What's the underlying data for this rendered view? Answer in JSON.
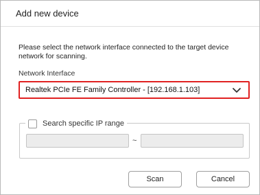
{
  "dialog": {
    "title": "Add new device",
    "description": "Please select the network interface connected to the target device network for scanning.",
    "network_interface_label": "Network Interface",
    "network_interface_selected": "Realtek PCIe FE Family Controller - [192.168.1.103]",
    "ip_range_checkbox_label": "Search specific IP range",
    "ip_range_checked": false,
    "ip_start_value": "",
    "ip_end_value": "",
    "ip_separator": "~",
    "scan_button": "Scan",
    "cancel_button": "Cancel"
  },
  "icons": {
    "select_arrow": "chevron-down-icon"
  },
  "colors": {
    "highlight_border": "#e02020",
    "disabled_field": "#ececec"
  }
}
